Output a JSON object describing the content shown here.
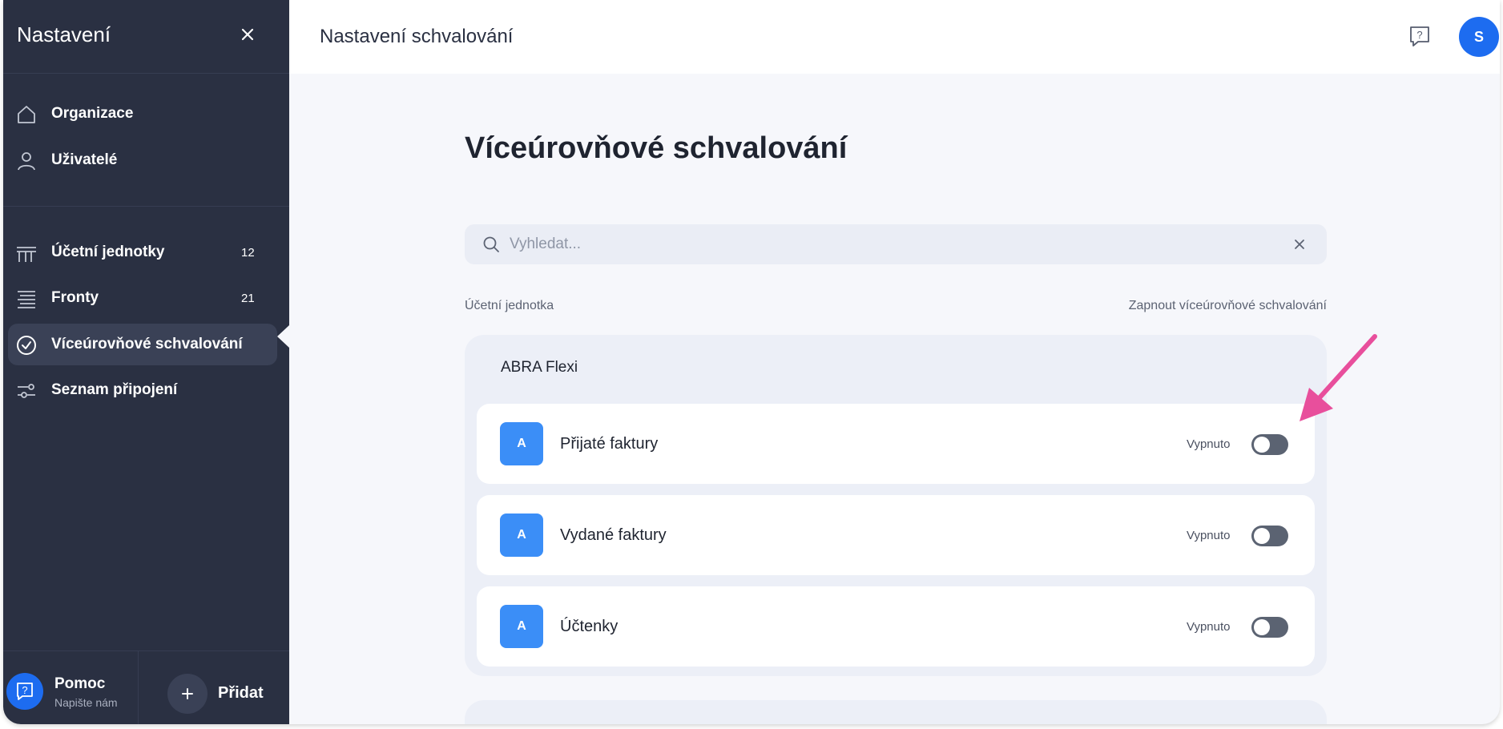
{
  "sidebar": {
    "title": "Nastavení",
    "nav_top": [
      {
        "label": "Organizace",
        "icon": "home-icon"
      },
      {
        "label": "Uživatelé",
        "icon": "user-icon"
      }
    ],
    "nav_main": [
      {
        "label": "Účetní jednotky",
        "count": "12",
        "icon": "building-icon"
      },
      {
        "label": "Fronty",
        "count": "21",
        "icon": "queue-icon"
      },
      {
        "label": "Víceúrovňové schvalování",
        "icon": "check-circle-icon",
        "active": true
      },
      {
        "label": "Seznam připojení",
        "icon": "sliders-icon"
      }
    ],
    "footer": {
      "help_title": "Pomoc",
      "help_subtitle": "Napište nám",
      "add_label": "Přidat"
    }
  },
  "topbar": {
    "title": "Nastavení schvalování",
    "avatar_initial": "S"
  },
  "main": {
    "heading": "Víceúrovňové schvalování",
    "search": {
      "placeholder": "Vyhledat...",
      "value": ""
    },
    "columns": {
      "left": "Účetní jednotka",
      "right": "Zapnout víceúrovňové schvalování"
    },
    "groups": [
      {
        "title": "ABRA Flexi",
        "items": [
          {
            "badge": "A",
            "name": "Přijaté faktury",
            "state": "Vypnuto",
            "enabled": false
          },
          {
            "badge": "A",
            "name": "Vydané faktury",
            "state": "Vypnuto",
            "enabled": false
          },
          {
            "badge": "A",
            "name": "Účtenky",
            "state": "Vypnuto",
            "enabled": false
          }
        ]
      }
    ]
  },
  "colors": {
    "sidebar_bg": "#2a3042",
    "accent": "#1d6cf0",
    "badge": "#3b8ef7",
    "toggle_off": "#5b6372",
    "annotation_arrow": "#e84f9c"
  }
}
